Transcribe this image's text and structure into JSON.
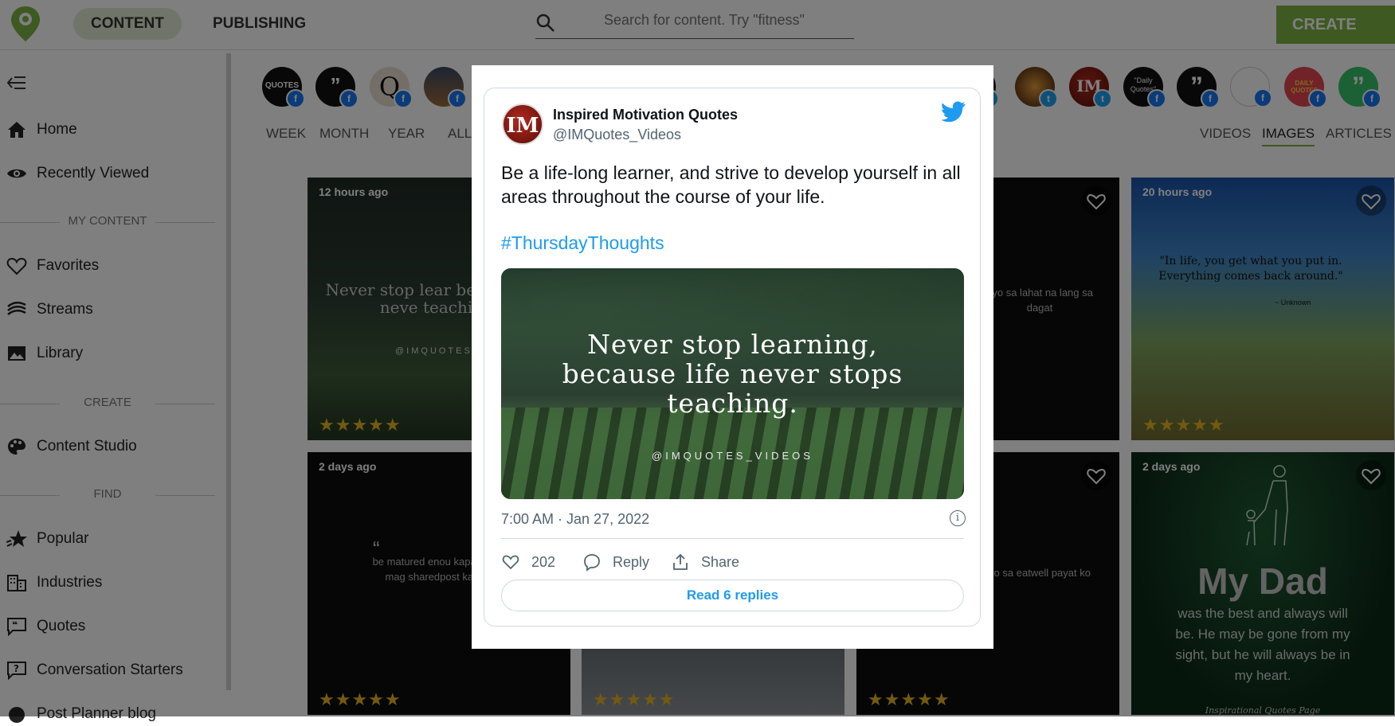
{
  "topbar": {
    "tabs": [
      "CONTENT",
      "PUBLISHING"
    ],
    "search_placeholder": "Search for content. Try \"fitness\"",
    "create_post": "CREATE POST"
  },
  "sidebar": {
    "items": [
      {
        "label": "Home",
        "icon": "home-icon"
      },
      {
        "label": "Recently Viewed",
        "icon": "eye-icon"
      },
      {
        "label": "Favorites",
        "icon": "heart-icon"
      },
      {
        "label": "Streams",
        "icon": "streams-icon"
      },
      {
        "label": "Library",
        "icon": "image-icon"
      },
      {
        "label": "Content Studio",
        "icon": "palette-icon"
      },
      {
        "label": "Popular",
        "icon": "star-icon"
      },
      {
        "label": "Industries",
        "icon": "building-icon"
      },
      {
        "label": "Quotes",
        "icon": "quote-icon"
      },
      {
        "label": "Conversation Starters",
        "icon": "question-icon"
      },
      {
        "label": "Post Planner blog",
        "icon": "blog-icon"
      }
    ],
    "sections": [
      "MY CONTENT",
      "CREATE",
      "FIND"
    ]
  },
  "filters": {
    "time": [
      "WEEK",
      "MONTH",
      "YEAR",
      "ALL"
    ],
    "type": [
      "VIDEOS",
      "IMAGES",
      "ARTICLES"
    ],
    "active_type": "IMAGES"
  },
  "avatars_left": [
    {
      "text": "QUOTES",
      "network": "facebook"
    },
    {
      "text": "”",
      "network": "facebook"
    },
    {
      "text": "Q",
      "network": "facebook"
    },
    {
      "text": "",
      "network": "facebook"
    }
  ],
  "avatars_right": [
    {
      "text": "",
      "network": "twitter"
    },
    {
      "text": "",
      "network": "twitter"
    },
    {
      "text": "IM",
      "network": "twitter"
    },
    {
      "text": "\"Daily Quotes\"",
      "network": "facebook"
    },
    {
      "text": "”",
      "network": "facebook"
    },
    {
      "text": "",
      "network": "facebook"
    },
    {
      "text": "DAILY QUOTES",
      "network": "facebook"
    },
    {
      "text": "”",
      "network": "facebook"
    }
  ],
  "cards": {
    "c1": {
      "time": "12 hours ago",
      "quote": "Never stop lear because life neve teaching.",
      "watermark": "@IMQUOTES_VID",
      "stars": "★★★★★"
    },
    "c2": {
      "text": "ayo sa lahat na lang sa dagat"
    },
    "c3": {
      "time": "20 hours ago",
      "quote": "\"In life, you get what you put in. Everything comes back around.\"",
      "author": "~ Unknown",
      "stars": "★★★★★"
    },
    "c4": {
      "time": "2 days ago",
      "quote_mark": "“",
      "text": "be matured enou kapag wala kang ka mag sharedpost ka kada minuto",
      "stars": "★★★★★"
    },
    "c5": {
      "stars": "★★★★★"
    },
    "c6": {
      "text": "ko sa eatwell payat ko",
      "stars": "★★★★★"
    },
    "c7": {
      "time": "2 days ago",
      "title": "My Dad",
      "body": "was the best and always will be. He may be gone from my sight, but he will always be in my heart.",
      "footer": "Inspirational Quotes Page"
    }
  },
  "tweet": {
    "name": "Inspired Motivation Quotes",
    "handle": "@IMQuotes_Videos",
    "avatar_text": "IM",
    "text": "Be a life-long learner, and strive to develop yourself in all areas throughout the course of your life.",
    "hashtag": "#ThursdayThoughts",
    "image_lines": [
      "Never stop learning,",
      "because life never stops",
      "teaching."
    ],
    "image_watermark": "@IMQUOTES_VIDEOS",
    "timestamp": "7:00 AM · Jan 27, 2022",
    "info_icon": "i",
    "likes": "202",
    "reply": "Reply",
    "share": "Share",
    "read_replies": "Read 6 replies"
  },
  "colors": {
    "accent": "#7cb342",
    "twitter_blue": "#1d9bf0",
    "facebook_blue": "#1877f2"
  }
}
